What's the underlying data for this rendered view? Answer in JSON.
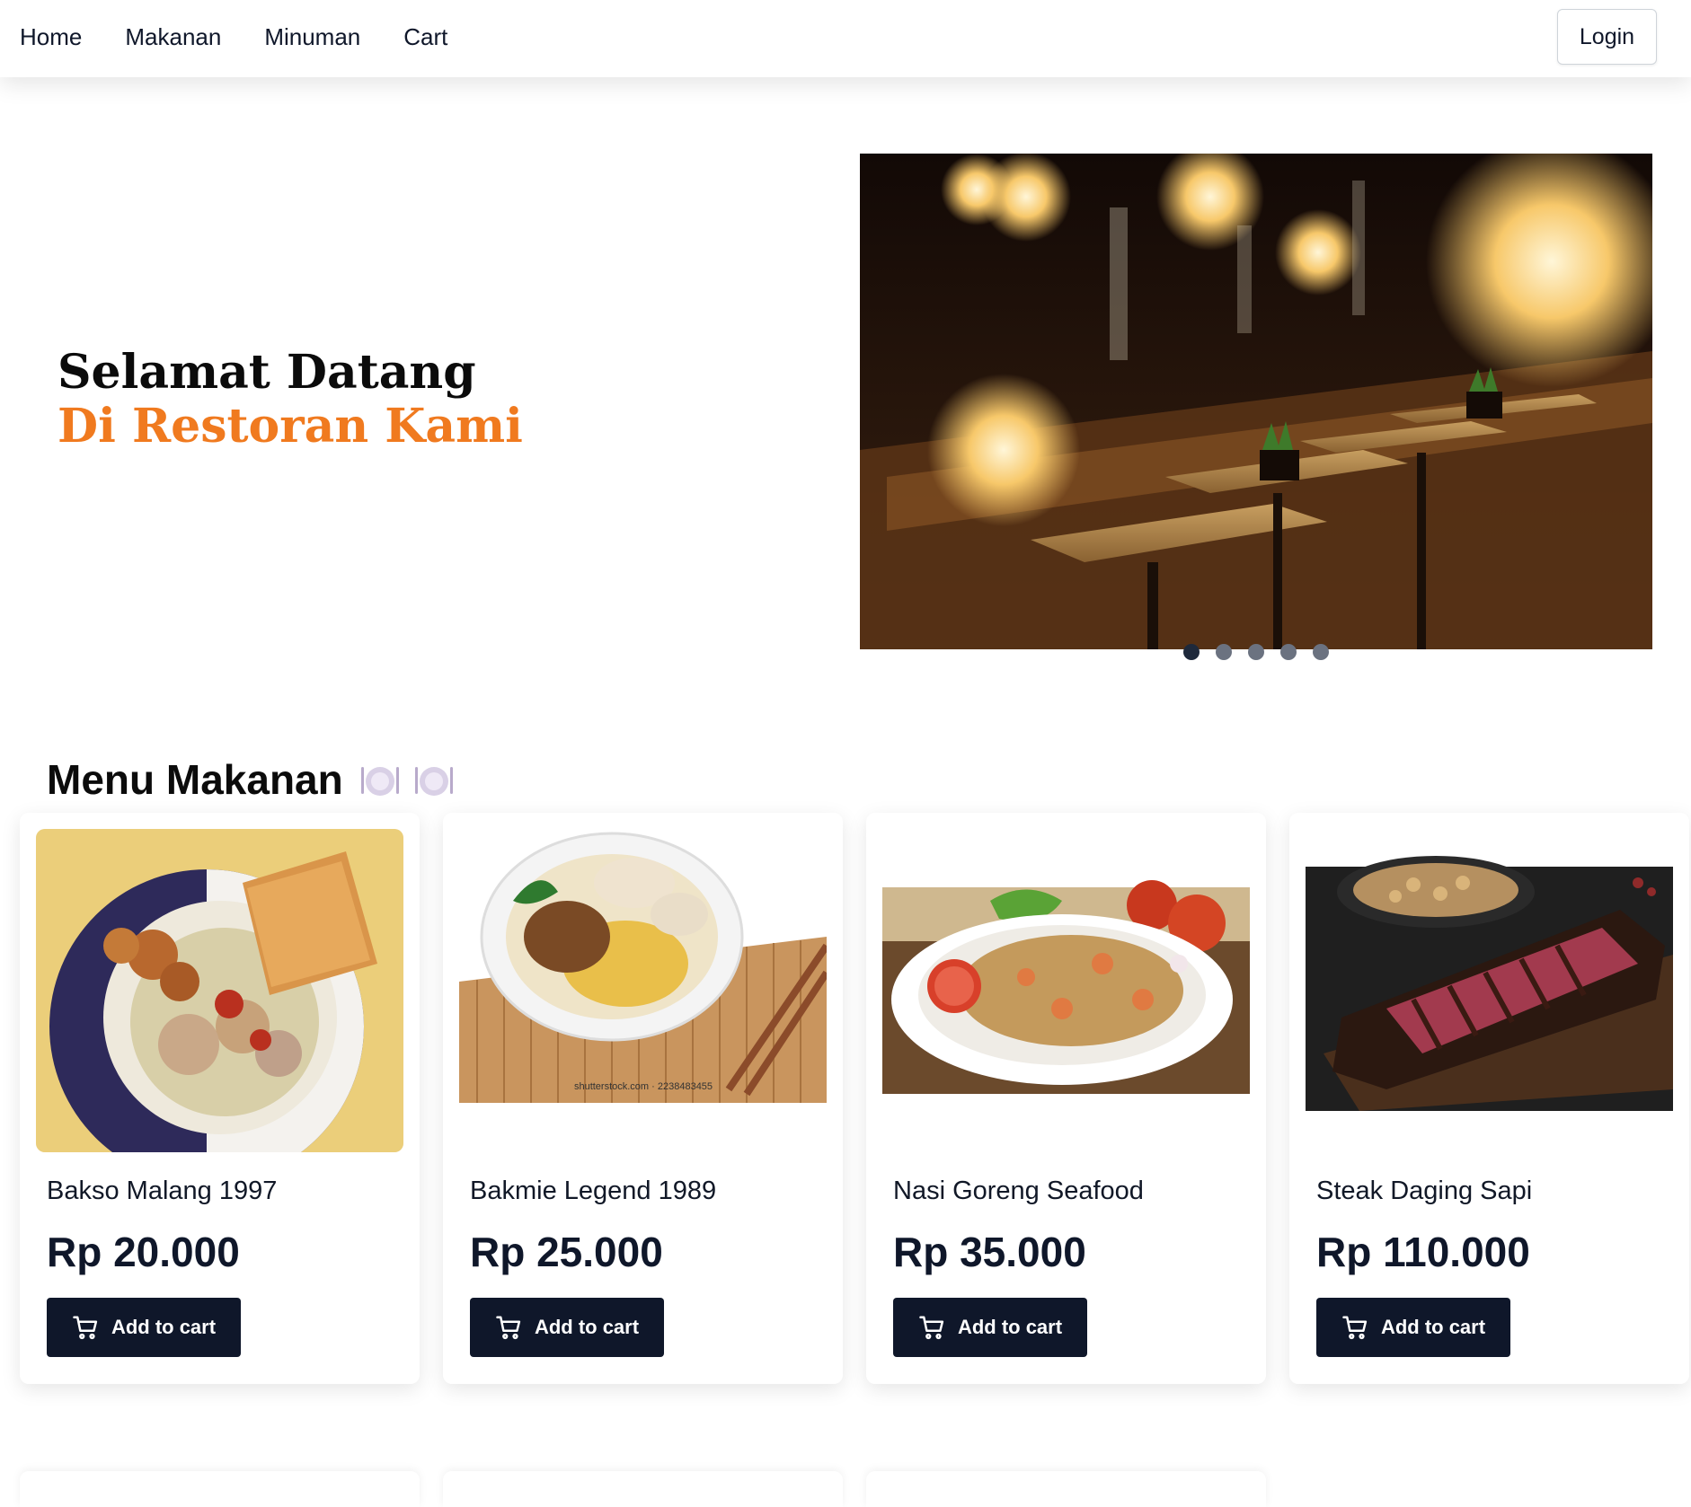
{
  "nav": {
    "links": [
      "Home",
      "Makanan",
      "Minuman",
      "Cart"
    ],
    "login_label": "Login"
  },
  "hero": {
    "title_line1": "Selamat Datang",
    "title_line2": "Di Restoran Kami",
    "accent_color": "#f07a1f",
    "carousel": {
      "slide_count": 5,
      "active_index": 0
    }
  },
  "menu": {
    "title": "Menu Makanan",
    "title_icons": [
      "plate-with-cutlery-icon",
      "plate-with-cutlery-icon"
    ],
    "items": [
      {
        "name": "Bakso Malang 1997",
        "price": "Rp 20.000",
        "button": "Add to cart"
      },
      {
        "name": "Bakmie Legend 1989",
        "price": "Rp 25.000",
        "button": "Add to cart",
        "image_caption": "shutterstock.com · 2238483455"
      },
      {
        "name": "Nasi Goreng Seafood",
        "price": "Rp 35.000",
        "button": "Add to cart"
      },
      {
        "name": "Steak Daging Sapi",
        "price": "Rp 110.000",
        "button": "Add to cart"
      }
    ]
  },
  "colors": {
    "button_bg": "#0f172a",
    "text": "#0f172a"
  }
}
